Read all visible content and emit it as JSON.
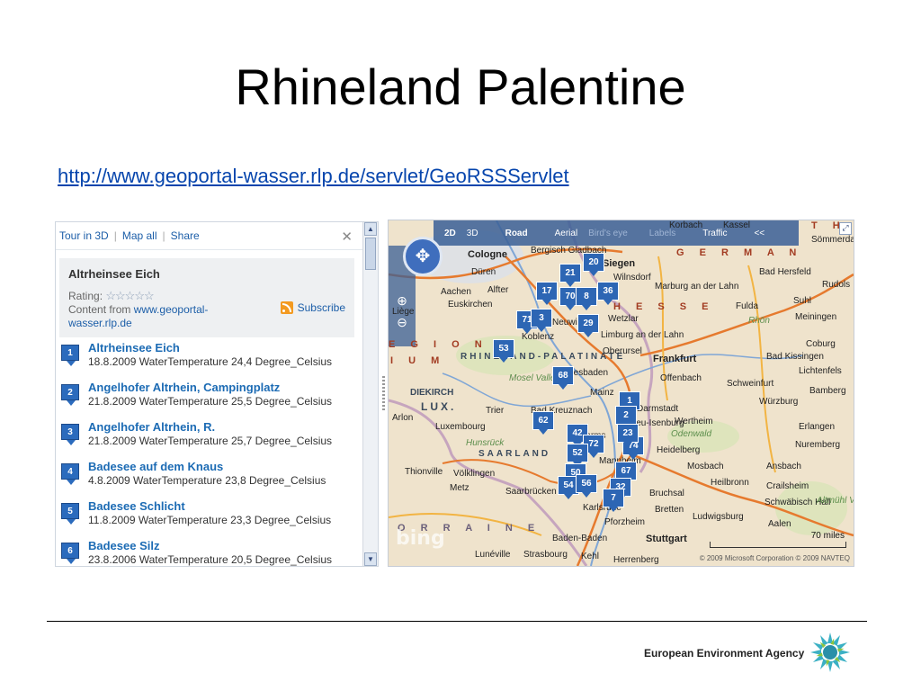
{
  "slide": {
    "title": "Rhineland Palentine",
    "link": "http://www.geoportal-wasser.rlp.de/servlet/GeoRSSServlet"
  },
  "panel": {
    "toolbar": {
      "tour": "Tour in 3D",
      "map_all": "Map all",
      "share": "Share",
      "close": "✕"
    },
    "info": {
      "title": "Altrheinsee Eich",
      "rating_label": "Rating:",
      "stars": "☆☆☆☆☆",
      "content_from": "Content from",
      "content_link": "www.geoportal-wasser.rlp.de",
      "subscribe": "Subscribe"
    },
    "results": [
      {
        "num": "1",
        "title": "Altrheinsee Eich",
        "desc": "18.8.2009 WaterTemperature 24,4 Degree_Celsius"
      },
      {
        "num": "2",
        "title": "Angelhofer Altrhein, Campingplatz",
        "desc": "21.8.2009 WaterTemperature 25,5 Degree_Celsius"
      },
      {
        "num": "3",
        "title": "Angelhofer Altrhein, R.",
        "desc": "21.8.2009 WaterTemperature 25,7 Degree_Celsius"
      },
      {
        "num": "4",
        "title": "Badesee auf dem Knaus",
        "desc": "4.8.2009 WaterTemperature 23,8 Degree_Celsius"
      },
      {
        "num": "5",
        "title": "Badesee Schlicht",
        "desc": "11.8.2009 WaterTemperature 23,3 Degree_Celsius"
      },
      {
        "num": "6",
        "title": "Badesee Silz",
        "desc": "23.8.2006 WaterTemperature 20,5 Degree_Celsius"
      }
    ]
  },
  "map": {
    "topbar": {
      "d2": "2D",
      "d3": "3D",
      "road": "Road",
      "aerial": "Aerial",
      "birds_eye": "Bird's eye",
      "labels": "Labels",
      "traffic": "Traffic",
      "collapse": "<<"
    },
    "scale": "70 miles",
    "brand": "bing",
    "copyright": "© 2009 Microsoft Corporation © 2009 NAVTEQ",
    "regions": {
      "germany": "G E R M A N",
      "hesse": "H E S S E",
      "lorraine": "O R R A I N E",
      "rhineland": "RHINELAND-PALATINATE",
      "saarland": "SAARLAND",
      "lux": "LUX.",
      "diekirch": "DIEKIRCH",
      "region_left": "E G I O N",
      "region_left2": "I U M",
      "thuringia": "T H U R I N"
    },
    "places": [
      "Cologne",
      "Bergisch Gladbach",
      "Siegen",
      "Wilnsdorf",
      "Düren",
      "Alfter",
      "Euskirchen",
      "Aachen",
      "Neuwied",
      "Koblenz",
      "Wetzlar",
      "Limburg an der Lahn",
      "Marburg an der Lahn",
      "Bad Hersfeld",
      "Fulda",
      "Suhl",
      "Meiningen",
      "Frankfurt",
      "Wiesbaden",
      "Offenbach",
      "Mainz",
      "Darmstadt",
      "Worms",
      "Mannheim",
      "Heidelberg",
      "Wertheim",
      "Würzburg",
      "Schweinfurt",
      "Coburg",
      "Bad Kissingen",
      "Lichtenfels",
      "Bamberg",
      "Erlangen",
      "Nuremberg",
      "Ansbach",
      "Crailsheim",
      "Schwäbisch Hall",
      "Aalen",
      "Heilbronn",
      "Mosbach",
      "Ludwigsburg",
      "Stuttgart",
      "Pforzheim",
      "Karlsruhe",
      "Bretten",
      "Bruchsal",
      "Baden-Baden",
      "Kehl",
      "Herrenberg",
      "Strasbourg",
      "Lunéville",
      "Saarbrücken",
      "Völklingen",
      "Thionville",
      "Luxembourg",
      "Arlon",
      "Trier",
      "Bad Kreuznach",
      "Oberursel",
      "Mosel Valley",
      "Hunsrück",
      "Odenwald",
      "Rhön",
      "Altmühl Valley",
      "Metz",
      "Sömmerda",
      "Rudols",
      "Korbach",
      "Kassel",
      "Liège",
      "Neu-Isenburg"
    ],
    "markers": [
      "20",
      "21",
      "17",
      "70",
      "36",
      "8",
      "71",
      "3",
      "29",
      "53",
      "68",
      "62",
      "42",
      "72",
      "52",
      "74",
      "67",
      "50",
      "54",
      "56",
      "1",
      "32",
      "2",
      "23",
      "7"
    ]
  },
  "footer": {
    "agency": "European Environment Agency"
  }
}
